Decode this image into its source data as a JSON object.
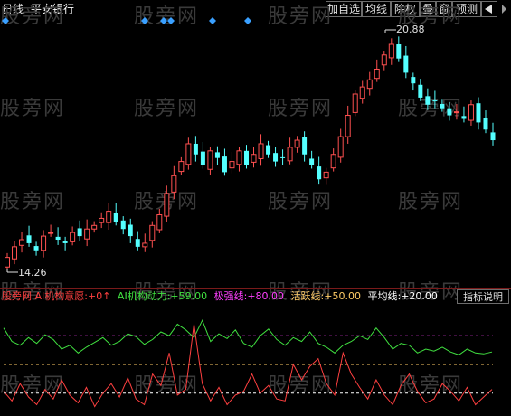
{
  "header": {
    "period": "日线",
    "stock_name": "平安银行"
  },
  "toolbar": {
    "buttons": [
      "加自选",
      "均线",
      "除权",
      "叠",
      "窗",
      "预测"
    ],
    "back_icon": "back-arrow-icon"
  },
  "watermark": "股旁网",
  "price_chart": {
    "high_label": "20.88",
    "low_label": "14.26"
  },
  "indicator_bar": {
    "name": "股旁网",
    "items": [
      {
        "label": "AI机构意愿:",
        "value": "+0↑",
        "color": "#ff4040"
      },
      {
        "label": "AI机构动力:",
        "value": "+59.00",
        "color": "#40e040"
      },
      {
        "label": "极强线:",
        "value": "+80.00",
        "color": "#ff40ff"
      },
      {
        "label": "活跃线:",
        "value": "+50.00",
        "color": "#ffcc66"
      },
      {
        "label": "平均线:",
        "value": "+20.00",
        "color": "#ffffff"
      }
    ],
    "help_button": "指标说明"
  },
  "colors": {
    "up": "#ff5050",
    "down": "#54ffff",
    "marker": "#3aa0ff"
  },
  "chart_data": [
    {
      "type": "candlestick",
      "title": "平安银行",
      "ylim": [
        14.26,
        20.88
      ],
      "annotations": [
        "20.88",
        "14.26"
      ]
    },
    {
      "type": "line",
      "series": [
        {
          "name": "AI机构意愿",
          "color": "#ff4040"
        },
        {
          "name": "AI机构动力",
          "color": "#40e040"
        }
      ],
      "reference_lines": [
        {
          "name": "极强线",
          "value": 80,
          "color": "#ff40ff"
        },
        {
          "name": "活跃线",
          "value": 50,
          "color": "#ffcc66"
        },
        {
          "name": "平均线",
          "value": 20,
          "color": "#ffffff"
        }
      ]
    }
  ]
}
